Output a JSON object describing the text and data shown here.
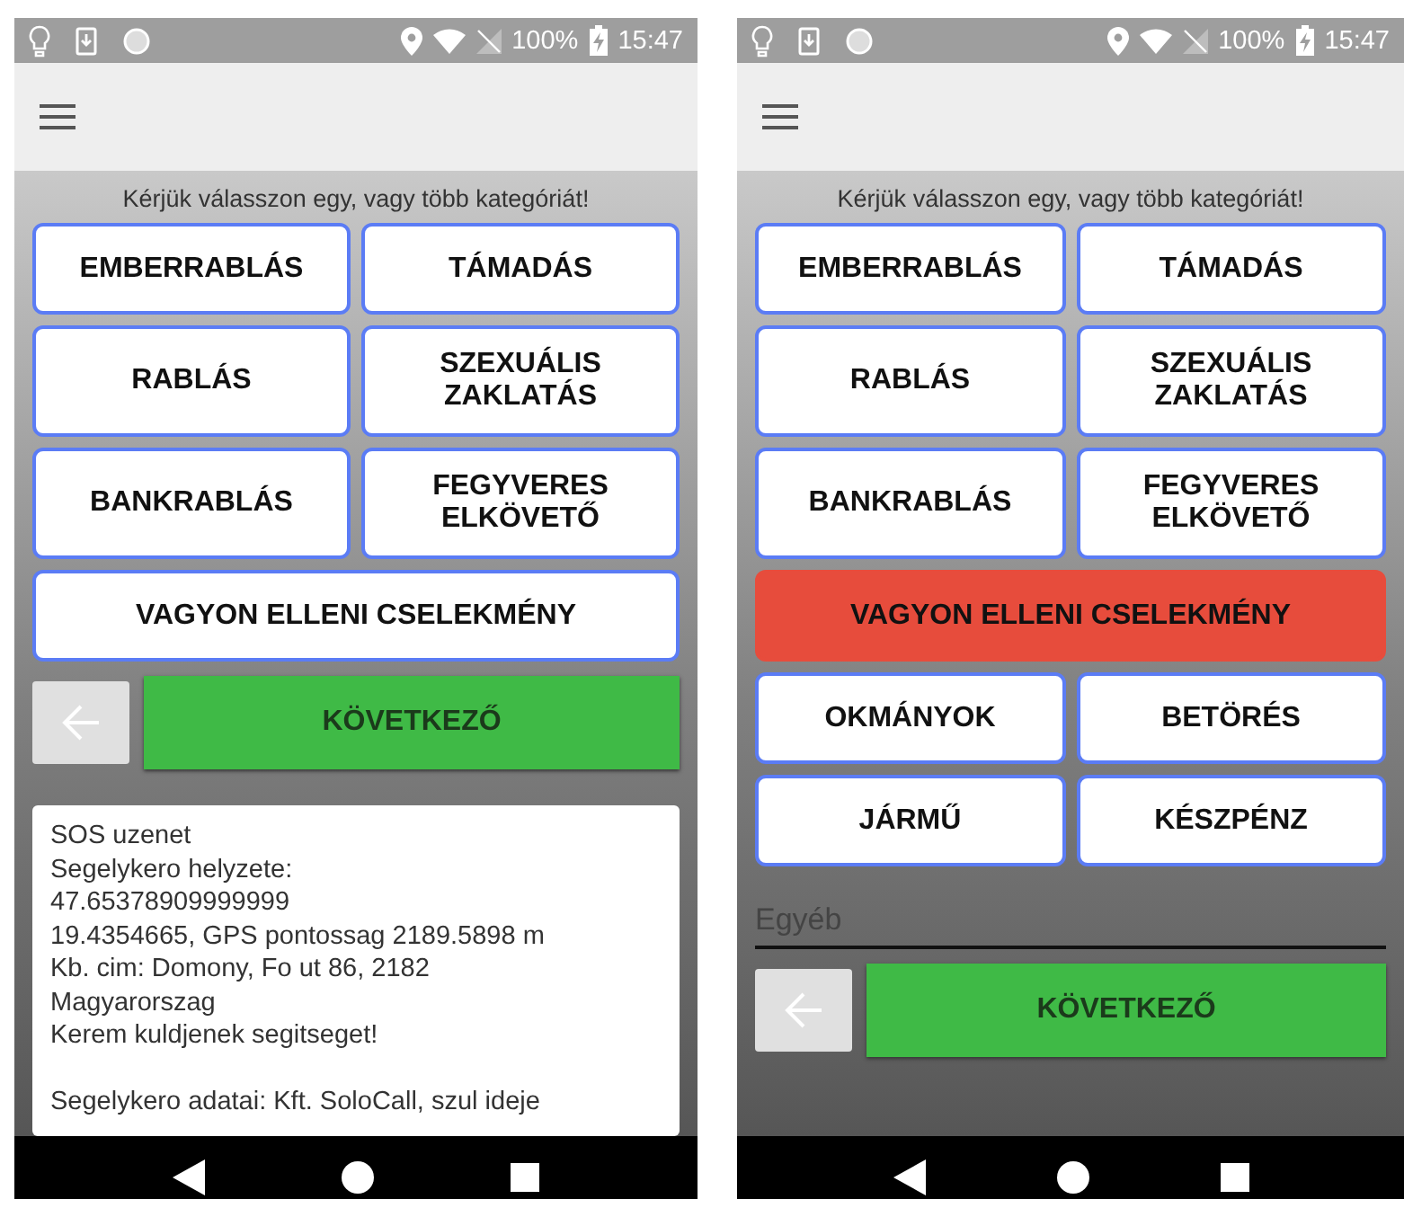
{
  "phones": [
    {
      "status_bar": {
        "battery": "100%",
        "time": "15:47"
      },
      "prompt": "Kérjük válasszon egy, vagy több kategóriát!",
      "categories": [
        {
          "label": "EMBERRABLÁS",
          "kind": "half",
          "selected": false
        },
        {
          "label": "TÁMADÁS",
          "kind": "half",
          "selected": false
        },
        {
          "label": "RABLÁS",
          "kind": "half",
          "selected": false
        },
        {
          "label": "SZEXUÁLIS ZAKLATÁS",
          "kind": "half",
          "selected": false
        },
        {
          "label": "BANKRABLÁS",
          "kind": "half",
          "selected": false
        },
        {
          "label": "FEGYVERES ELKÖVETŐ",
          "kind": "half",
          "selected": false
        },
        {
          "label": "VAGYON ELLENI CSELEKMÉNY",
          "kind": "wide",
          "selected": false
        }
      ],
      "next_button": "KÖVETKEZŐ",
      "message_paragraphs": [
        [
          "SOS uzenet",
          "Segelykero helyzete:",
          "47.65378909999999",
          "19.4354665, GPS pontossag 2189.5898 m",
          "Kb. cim: Domony, Fo ut 86, 2182",
          "Magyarorszag",
          "Kerem kuldjenek segitseget!"
        ],
        [
          "Segelykero adatai: Kft. SoloCall, szul ideje"
        ]
      ]
    },
    {
      "status_bar": {
        "battery": "100%",
        "time": "15:47"
      },
      "prompt": "Kérjük válasszon egy, vagy több kategóriát!",
      "categories": [
        {
          "label": "EMBERRABLÁS",
          "kind": "half",
          "selected": false
        },
        {
          "label": "TÁMADÁS",
          "kind": "half",
          "selected": false
        },
        {
          "label": "RABLÁS",
          "kind": "half",
          "selected": false
        },
        {
          "label": "SZEXUÁLIS ZAKLATÁS",
          "kind": "half",
          "selected": false
        },
        {
          "label": "BANKRABLÁS",
          "kind": "half",
          "selected": false
        },
        {
          "label": "FEGYVERES ELKÖVETŐ",
          "kind": "half",
          "selected": false
        },
        {
          "label": "VAGYON ELLENI CSELEKMÉNY",
          "kind": "wide",
          "selected": true
        },
        {
          "label": "OKMÁNYOK",
          "kind": "half",
          "selected": false
        },
        {
          "label": "BETÖRÉS",
          "kind": "half",
          "selected": false
        },
        {
          "label": "JÁRMŰ",
          "kind": "half",
          "selected": false
        },
        {
          "label": "KÉSZPÉNZ",
          "kind": "half",
          "selected": false
        }
      ],
      "other_field": {
        "placeholder": "Egyéb"
      },
      "next_button": "KÖVETKEZŐ"
    }
  ]
}
